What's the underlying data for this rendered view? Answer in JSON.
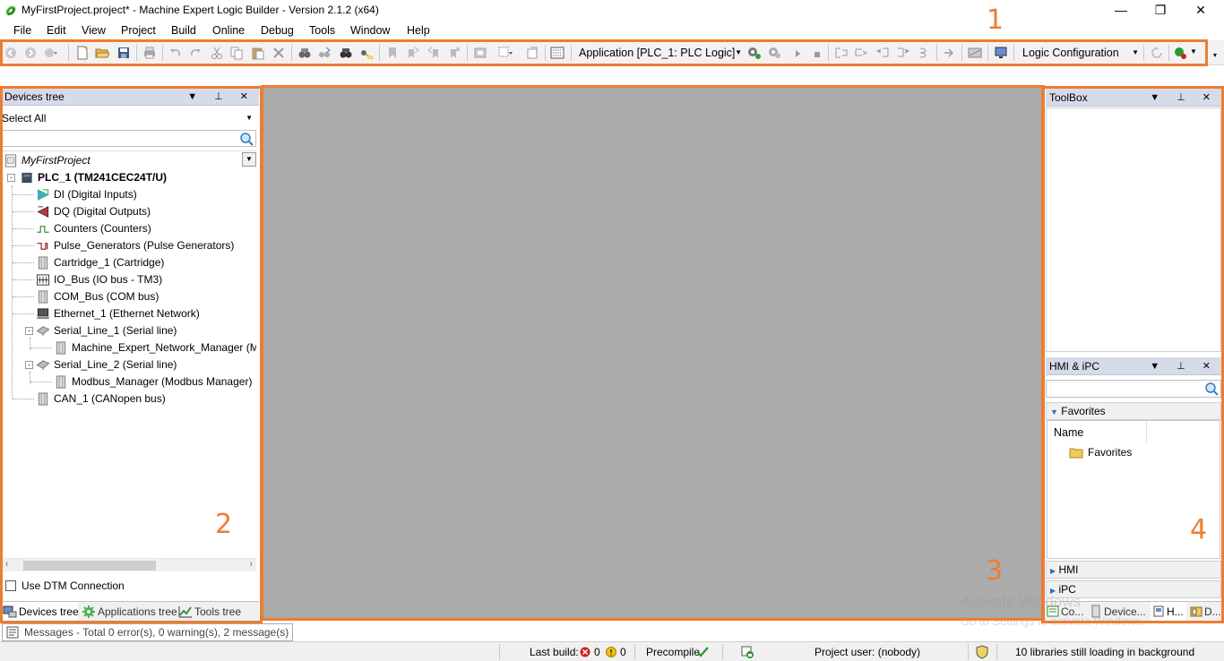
{
  "window": {
    "title": "MyFirstProject.project* - Machine Expert Logic Builder - Version 2.1.2 (x64)",
    "minimize": "—",
    "restore": "❐",
    "close": "✕"
  },
  "menu": [
    "File",
    "Edit",
    "View",
    "Project",
    "Build",
    "Online",
    "Debug",
    "Tools",
    "Window",
    "Help"
  ],
  "toolbar": {
    "application_combo": "Application [PLC_1: PLC Logic]",
    "configuration_combo": "Logic Configuration"
  },
  "annotations": {
    "n1": "1",
    "n2": "2",
    "n3": "3",
    "n4": "4"
  },
  "devices_panel": {
    "title": "Devices tree",
    "filter": "Select All",
    "tree": {
      "project": "MyFirstProject",
      "plc": "PLC_1 (TM241CEC24T/U)",
      "items": [
        "DI (Digital Inputs)",
        "DQ (Digital Outputs)",
        "Counters (Counters)",
        "Pulse_Generators (Pulse Generators)",
        "Cartridge_1 (Cartridge)",
        "IO_Bus (IO bus - TM3)",
        "COM_Bus (COM bus)",
        "Ethernet_1 (Ethernet Network)",
        "Serial_Line_1 (Serial line)",
        "Machine_Expert_Network_Manager (Mach",
        "Serial_Line_2 (Serial line)",
        "Modbus_Manager (Modbus Manager)",
        "CAN_1 (CANopen bus)"
      ]
    },
    "dtm_label": "Use DTM Connection",
    "tabs": [
      "Devices tree",
      "Applications tree",
      "Tools tree"
    ]
  },
  "toolbox_panel": {
    "title": "ToolBox"
  },
  "hmi_panel": {
    "title": "HMI & iPC",
    "favorites_section": "Favorites",
    "name_header": "Name",
    "favorites_folder": "Favorites",
    "hmi_section": "HMI",
    "ipc_section": "iPC",
    "tabs": [
      "Co...",
      "Device...",
      "H...",
      "D..."
    ]
  },
  "messages": {
    "label": "Messages - Total 0 error(s), 0 warning(s), 2 message(s)"
  },
  "status": {
    "last_build": "Last build:",
    "errors": "0",
    "warnings": "0",
    "precompile": "Precompile",
    "project_user": "Project user: (nobody)",
    "libraries": "10 libraries still loading in background"
  },
  "watermark": {
    "line1": "Activate Windows",
    "line2": "Go to Settings to activate Windows."
  },
  "colors": {
    "highlight": "#ed7d31",
    "panel_header": "#d6dbe9",
    "workspace": "#ababab"
  }
}
